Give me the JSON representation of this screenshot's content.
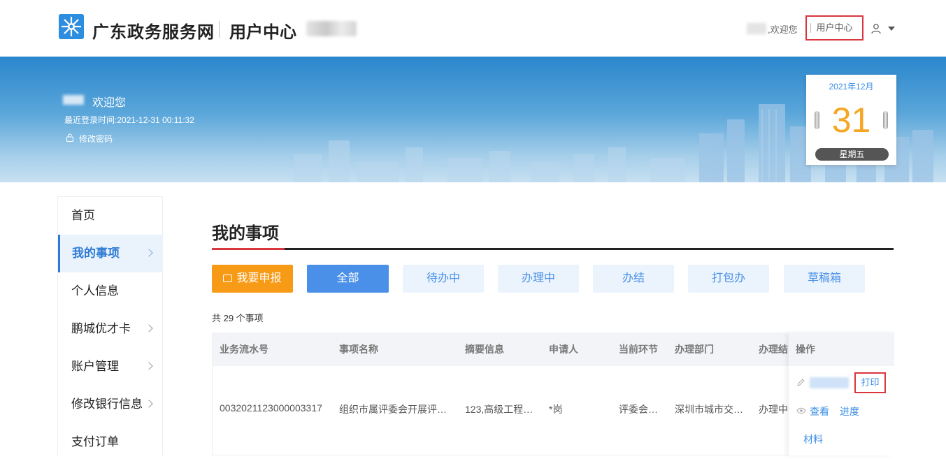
{
  "header": {
    "site_name": "广东政务服务网",
    "user_center_title": "用户中心",
    "welcome_text": ",欢迎您",
    "user_center_link": "用户中心",
    "logo_icon": "gd-gov-logo-icon",
    "user_icon": "user-icon",
    "dropdown_icon": "caret-down-icon"
  },
  "banner": {
    "welcome": "欢迎您",
    "last_login_label": "最近登录时间:",
    "last_login_time": "2021-12-31 00:11:32",
    "change_password": "修改密码",
    "calendar": {
      "month": "2021年12月",
      "day": "31",
      "weekday": "星期五"
    }
  },
  "sidebar": {
    "items": [
      {
        "label": "首页",
        "has_arrow": false,
        "active": false
      },
      {
        "label": "我的事项",
        "has_arrow": true,
        "active": true
      },
      {
        "label": "个人信息",
        "has_arrow": false,
        "active": false
      },
      {
        "label": "鹏城优才卡",
        "has_arrow": true,
        "active": false
      },
      {
        "label": "账户管理",
        "has_arrow": true,
        "active": false
      },
      {
        "label": "修改银行信息",
        "has_arrow": true,
        "active": false
      },
      {
        "label": "支付订单",
        "has_arrow": false,
        "active": false
      }
    ]
  },
  "main": {
    "title": "我的事项",
    "apply_button": "我要申报",
    "filters": [
      "全部",
      "待办中",
      "办理中",
      "办结",
      "打包办",
      "草稿箱"
    ],
    "count_text": "共 29 个事项",
    "table": {
      "headers": [
        "业务流水号",
        "事项名称",
        "摘要信息",
        "申请人",
        "当前环节",
        "办理部门",
        "办理结",
        "操作"
      ],
      "rows": [
        {
          "serial": "0032021123000003317",
          "name": "组织市属评委会开展评…",
          "summary": "123,高级工程…",
          "applicant": "*岗",
          "stage": "评委会…",
          "department": "深圳市城市交…",
          "status": "办理中"
        }
      ],
      "ops": {
        "print": "打印",
        "view": "查看",
        "progress": "进度",
        "material": "材料"
      }
    }
  },
  "colors": {
    "primary_blue": "#4a90e8",
    "orange": "#f79a15",
    "highlight_red": "#d9363e",
    "calendar_day": "#f5a623"
  }
}
